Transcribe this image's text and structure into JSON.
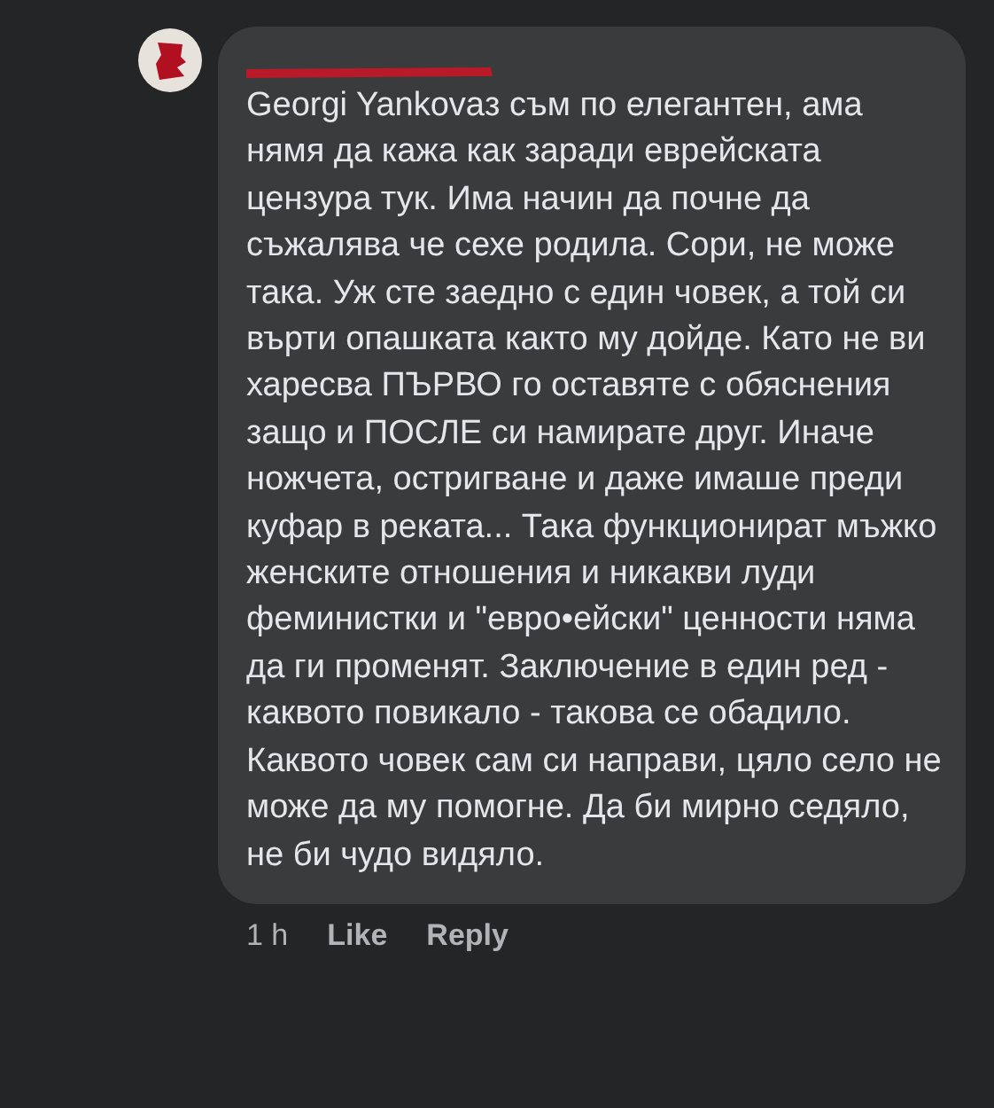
{
  "comment": {
    "text": "Georgi Yankovaз съм по елегантен, ама нямя да кажа как заради еврейската цензура тук. Има начин да почне да съжалява че сехе родила. Сори, не може така. Уж сте заедно с един човек, а той си върти опашката както му дойде. Като не ви харесва ПЪРВО го оставяте с обяснения защо и ПОСЛЕ си намирате друг. Иначе ножчета, остригване и даже имаше преди куфар в реката... Така функционират мъжко женските отношения и никакви луди феминистки и \"евро•ейски\" ценности няма да ги променят. Заключение в един ред - каквото повикало - такова се обадило. Каквото човек сам си направи, цяло село не може да му помогне. Да би мирно седяло, не би чудо видяло.",
    "time": "1 h",
    "actions": [
      "Like",
      "Reply"
    ]
  }
}
